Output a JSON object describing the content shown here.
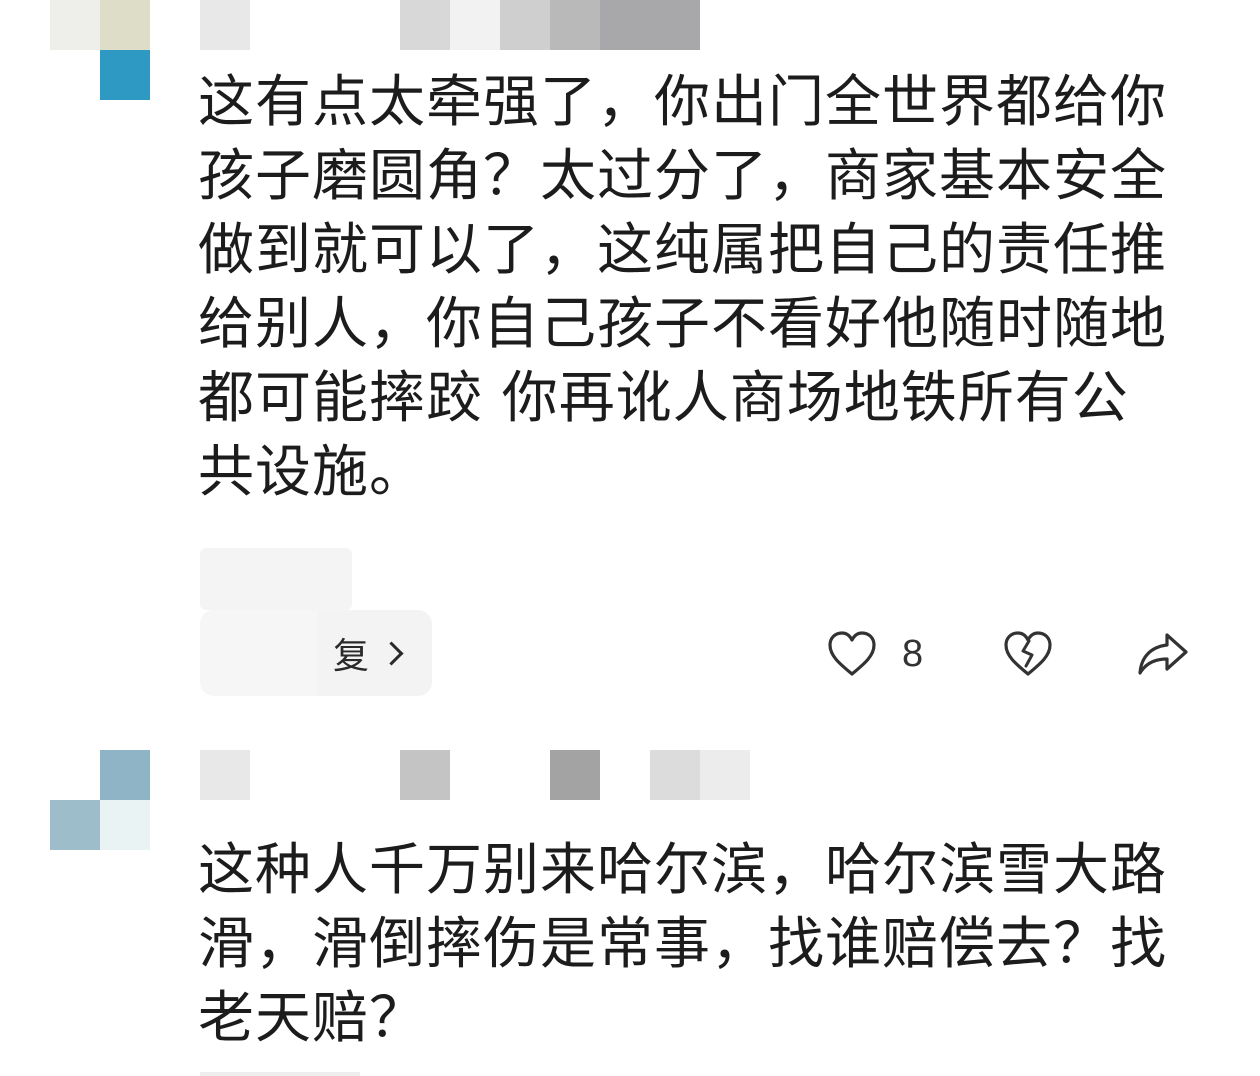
{
  "comments": [
    {
      "text": "这有点太牵强了，你出门全世界都给你孩子磨圆角？太过分了，商家基本安全做到就可以了，这纯属把自己的责任推给别人，你自己孩子不看好他随时随地都可能摔跤 你再讹人商场地铁所有公共设施。",
      "replies_label": "复",
      "like_count": "8",
      "avatar_colors": [
        "#eeeeea",
        "#ddddc8",
        "#ffffff",
        "#2e9ac3"
      ],
      "username_colors": [
        "#e8e8e8",
        "#ffffff",
        "#d8d8d8",
        "#f2f2f2",
        "#cfcfcf",
        "#b9b9ba",
        "#a8a8aa"
      ]
    },
    {
      "text": "这种人千万别来哈尔滨，哈尔滨雪大路滑，滑倒摔伤是常事，找谁赔偿去？找老天赔？",
      "avatar_colors": [
        "#ffffff",
        "#8fb4c5",
        "#9dbdca",
        "#eaf3f4"
      ],
      "username_colors": [
        "#e8e8e8",
        "#ffffff",
        "#c4c4c4",
        "#ffffff",
        "#a3a3a3",
        "#ffffff",
        "#dcdcdc",
        "#ececec"
      ]
    }
  ],
  "icons": {
    "like": "heart-icon",
    "dislike": "broken-heart-icon",
    "share": "share-icon",
    "chevron": "chevron-right-icon"
  }
}
